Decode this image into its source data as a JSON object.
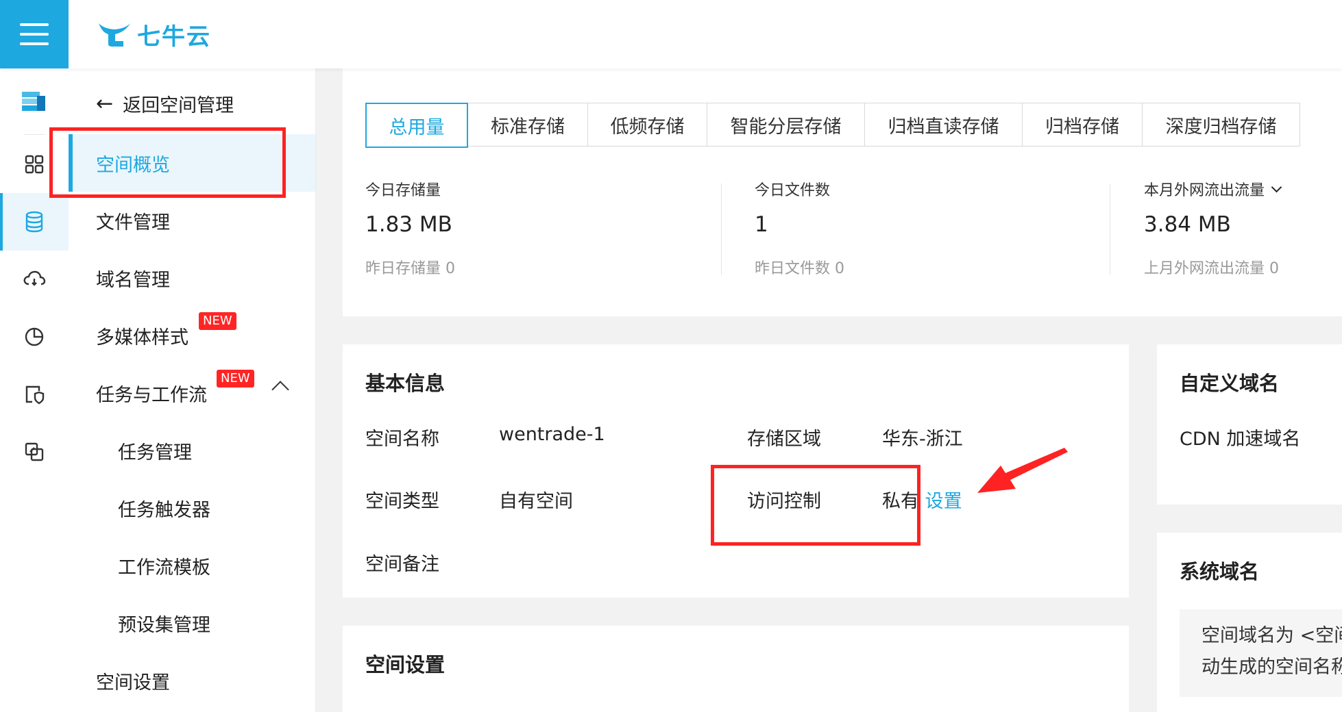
{
  "app": {
    "logo_text": "七牛云",
    "brand_color": "#1ea8e0",
    "annotation_color": "#ff2222"
  },
  "rail": {
    "icons": [
      "storage-stack-icon",
      "grid-icon",
      "database-icon",
      "cloud-sync-icon",
      "pie-chart-icon",
      "shield-doc-icon",
      "transfer-icon"
    ],
    "active": "database-icon"
  },
  "sidebar": {
    "back_label": "返回空间管理",
    "items": [
      {
        "label": "空间概览",
        "active": true
      },
      {
        "label": "文件管理"
      },
      {
        "label": "域名管理"
      },
      {
        "label": "多媒体样式",
        "badge": "NEW"
      },
      {
        "label": "任务与工作流",
        "badge": "NEW",
        "expanded": true
      },
      {
        "label": "任务管理"
      },
      {
        "label": "任务触发器"
      },
      {
        "label": "工作流模板"
      },
      {
        "label": "预设集管理"
      },
      {
        "label": "空间设置"
      }
    ]
  },
  "usage": {
    "tabs": [
      "总用量",
      "标准存储",
      "低频存储",
      "智能分层存储",
      "归档直读存储",
      "归档存储",
      "深度归档存储"
    ],
    "active_tab": "总用量",
    "stats": [
      {
        "title": "今日存储量",
        "value": "1.83 MB",
        "sub": "昨日存储量 0"
      },
      {
        "title": "今日文件数",
        "value": "1",
        "sub": "昨日文件数 0"
      },
      {
        "title": "本月外网流出流量",
        "value": "3.84 MB",
        "sub": "上月外网流出流量 0"
      }
    ]
  },
  "basic_info": {
    "title": "基本信息",
    "space_name_label": "空间名称",
    "space_name": "wentrade-1",
    "region_label": "存储区域",
    "region": "华东-浙江",
    "space_type_label": "空间类型",
    "space_type": "自有空间",
    "access_label": "访问控制",
    "access_value": "私有",
    "access_link": "设置",
    "remark_label": "空间备注"
  },
  "custom_domain": {
    "title": "自定义域名",
    "cdn_label": "CDN 加速域名"
  },
  "system_domain": {
    "title": "系统域名",
    "note_line1": "空间域名为 <空间",
    "note_line2": "动生成的空间名称"
  },
  "space_settings": {
    "title": "空间设置"
  }
}
